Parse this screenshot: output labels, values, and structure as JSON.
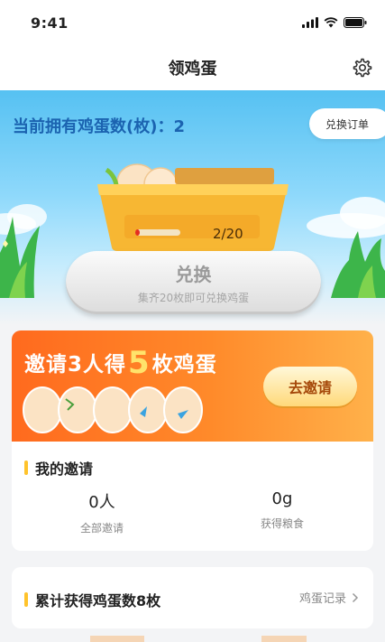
{
  "status": {
    "time": "9:41"
  },
  "nav": {
    "title": "领鸡蛋",
    "settings_icon": "gear-icon"
  },
  "hero": {
    "count_label": "当前拥有鸡蛋数(枚)：",
    "count_value": "2",
    "order_button": "兑换订单",
    "progress_text": "2/20",
    "progress_fraction": 0.1,
    "exchange_button": "兑换",
    "exchange_hint": "集齐20枚即可兑换鸡蛋"
  },
  "invite": {
    "headline_pre": "邀请3人得",
    "headline_num": "5",
    "headline_post": "枚鸡蛋",
    "button": "去邀请",
    "section_title": "我的邀请",
    "stats": [
      {
        "value": "0人",
        "label": "全部邀请"
      },
      {
        "value": "0g",
        "label": "获得粮食"
      }
    ]
  },
  "total": {
    "title": "累计获得鸡蛋数8枚",
    "link": "鸡蛋记录"
  },
  "colors": {
    "accent": "#ffc32b",
    "banner": "#ff7a24",
    "sky": "#56c1f2"
  }
}
